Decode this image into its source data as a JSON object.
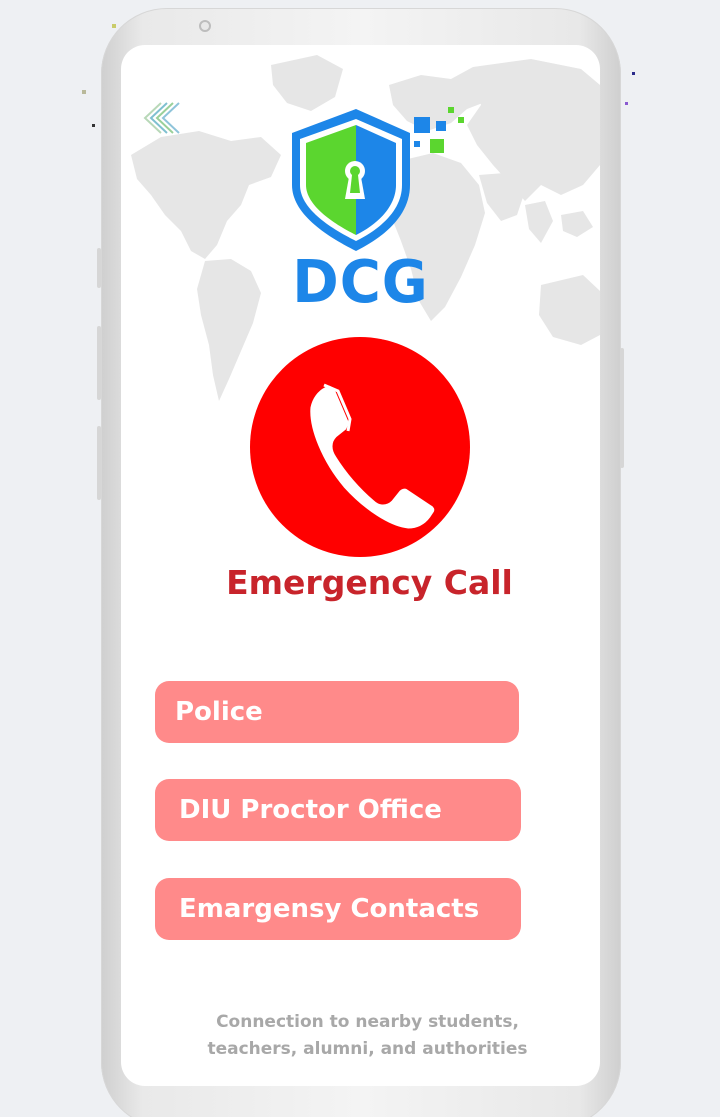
{
  "app": {
    "brand_name": "DCG"
  },
  "icons": {
    "back": "double-chevron-left-icon",
    "logo": "shield-keyhole-icon",
    "call": "phone-handset-icon",
    "background": "world-map"
  },
  "colors": {
    "brand_blue": "#1d86e8",
    "shield_green": "#5bd62f",
    "call_red": "#ff0000",
    "title_red": "#c8242b",
    "button_pink": "#ff8a8a",
    "footer_gray": "#a8a8a8"
  },
  "call": {
    "title": "Emergency Call"
  },
  "contacts": [
    {
      "label": "Police"
    },
    {
      "label": "DIU Proctor Office"
    },
    {
      "label": "Emargensy Contacts"
    }
  ],
  "footer": {
    "line1": "Connection to nearby students,",
    "line2": "teachers, alumni, and authorities"
  }
}
